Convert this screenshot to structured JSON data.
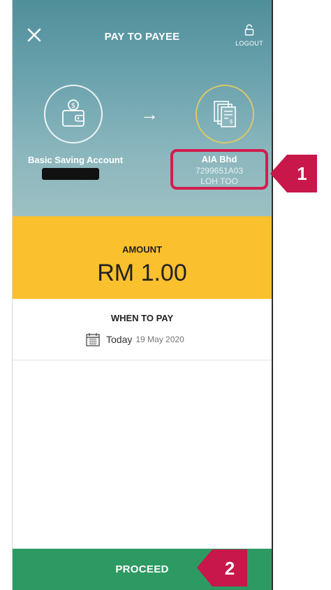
{
  "header": {
    "title": "PAY TO PAYEE",
    "logout_label": "LOGOUT"
  },
  "source": {
    "account_label": "Basic Saving Account"
  },
  "payee": {
    "name": "AIA Bhd",
    "account_number": "7299651A03",
    "holder": "LOH TOO"
  },
  "amount": {
    "label": "AMOUNT",
    "value": "RM 1.00"
  },
  "when": {
    "label": "WHEN TO PAY",
    "today": "Today",
    "date": "19 May 2020"
  },
  "footer": {
    "proceed_label": "PROCEED"
  },
  "callouts": {
    "one": "1",
    "two": "2"
  },
  "colors": {
    "amount_bg": "#fbc02d",
    "proceed_bg": "#2e9a63",
    "callout": "#c8174a"
  }
}
